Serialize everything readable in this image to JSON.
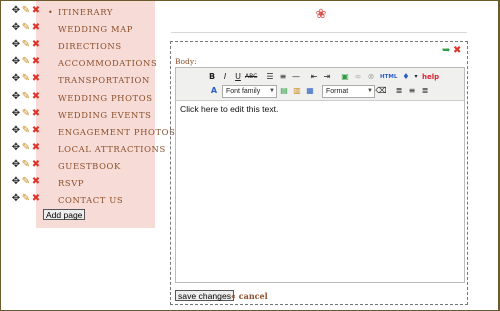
{
  "nav": {
    "items": [
      {
        "label": "ITINERARY",
        "bullet": "•"
      },
      {
        "label": "WEDDING MAP"
      },
      {
        "label": "DIRECTIONS"
      },
      {
        "label": "ACCOMMODATIONS"
      },
      {
        "label": "TRANSPORTATION"
      },
      {
        "label": "WEDDING PHOTOS"
      },
      {
        "label": "WEDDING EVENTS"
      },
      {
        "label": "ENGAGEMENT PHOTOS"
      },
      {
        "label": "LOCAL ATTRACTIONS"
      },
      {
        "label": "GUESTBOOK"
      },
      {
        "label": "RSVP"
      },
      {
        "label": "CONTACT US"
      }
    ],
    "icons": {
      "move": "move-icon",
      "edit": "pencil-icon",
      "delete": "delete-icon"
    },
    "add_page_label": "Add page"
  },
  "editor": {
    "field_label": "Body:",
    "toolbar_row1": [
      "B",
      "I",
      "U",
      "ABC",
      "bullets",
      "numbers",
      "rule",
      "outdent",
      "indent",
      "image",
      "link",
      "unlink",
      "HTML",
      "paste",
      "help"
    ],
    "help_label": "help",
    "html_label": "HTML",
    "font_family_select": "Font family",
    "format_select": "Format",
    "content": "Click here to edit this text."
  },
  "actions": {
    "save_label": "save changes",
    "cancel_label": "« cancel"
  },
  "colors": {
    "sidebar_bg": "#f7dbd6",
    "label_color": "#8b4f2a",
    "delete_red": "#e0342a",
    "border": "#6b5a2c"
  }
}
